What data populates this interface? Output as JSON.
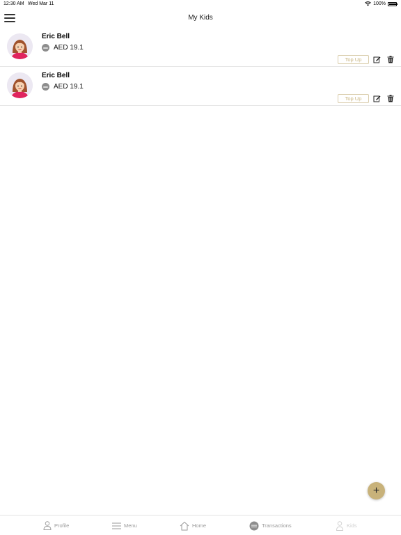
{
  "status_bar": {
    "time": "12:30 AM",
    "date": "Wed Mar 11",
    "battery": "100%",
    "battery_level": 1.0
  },
  "nav": {
    "title": "My Kids"
  },
  "kids": [
    {
      "name": "Eric Bell",
      "balance": "AED 19.1",
      "topup_label": "Top Up"
    },
    {
      "name": "Eric Bell",
      "balance": "AED 19.1",
      "topup_label": "Top Up"
    }
  ],
  "fab": {
    "symbol": "+"
  },
  "tabs": [
    {
      "label": "Profile",
      "icon": "person-icon"
    },
    {
      "label": "Menu",
      "icon": "menu-icon"
    },
    {
      "label": "Home",
      "icon": "home-icon"
    },
    {
      "label": "Transactions",
      "icon": "transactions-icon"
    },
    {
      "label": "Kids",
      "icon": "kid-icon"
    }
  ],
  "colors": {
    "accent": "#c8b27a",
    "topup_text": "#c9b582",
    "topup_border": "#d9ccaa",
    "tab_inactive": "#9a9a9a"
  }
}
